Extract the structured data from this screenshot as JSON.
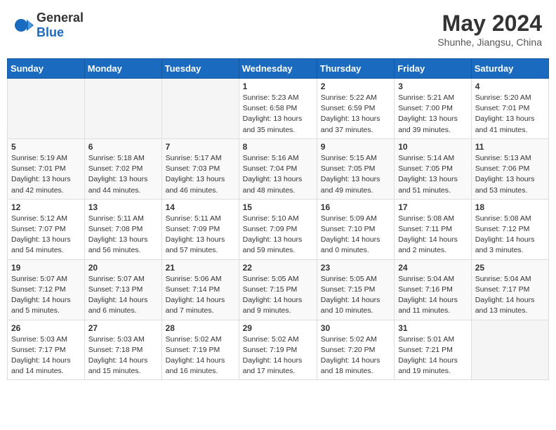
{
  "header": {
    "logo_general": "General",
    "logo_blue": "Blue",
    "month_year": "May 2024",
    "location": "Shunhe, Jiangsu, China"
  },
  "weekdays": [
    "Sunday",
    "Monday",
    "Tuesday",
    "Wednesday",
    "Thursday",
    "Friday",
    "Saturday"
  ],
  "weeks": [
    [
      {
        "day": "",
        "info": ""
      },
      {
        "day": "",
        "info": ""
      },
      {
        "day": "",
        "info": ""
      },
      {
        "day": "1",
        "info": "Sunrise: 5:23 AM\nSunset: 6:58 PM\nDaylight: 13 hours\nand 35 minutes."
      },
      {
        "day": "2",
        "info": "Sunrise: 5:22 AM\nSunset: 6:59 PM\nDaylight: 13 hours\nand 37 minutes."
      },
      {
        "day": "3",
        "info": "Sunrise: 5:21 AM\nSunset: 7:00 PM\nDaylight: 13 hours\nand 39 minutes."
      },
      {
        "day": "4",
        "info": "Sunrise: 5:20 AM\nSunset: 7:01 PM\nDaylight: 13 hours\nand 41 minutes."
      }
    ],
    [
      {
        "day": "5",
        "info": "Sunrise: 5:19 AM\nSunset: 7:01 PM\nDaylight: 13 hours\nand 42 minutes."
      },
      {
        "day": "6",
        "info": "Sunrise: 5:18 AM\nSunset: 7:02 PM\nDaylight: 13 hours\nand 44 minutes."
      },
      {
        "day": "7",
        "info": "Sunrise: 5:17 AM\nSunset: 7:03 PM\nDaylight: 13 hours\nand 46 minutes."
      },
      {
        "day": "8",
        "info": "Sunrise: 5:16 AM\nSunset: 7:04 PM\nDaylight: 13 hours\nand 48 minutes."
      },
      {
        "day": "9",
        "info": "Sunrise: 5:15 AM\nSunset: 7:05 PM\nDaylight: 13 hours\nand 49 minutes."
      },
      {
        "day": "10",
        "info": "Sunrise: 5:14 AM\nSunset: 7:05 PM\nDaylight: 13 hours\nand 51 minutes."
      },
      {
        "day": "11",
        "info": "Sunrise: 5:13 AM\nSunset: 7:06 PM\nDaylight: 13 hours\nand 53 minutes."
      }
    ],
    [
      {
        "day": "12",
        "info": "Sunrise: 5:12 AM\nSunset: 7:07 PM\nDaylight: 13 hours\nand 54 minutes."
      },
      {
        "day": "13",
        "info": "Sunrise: 5:11 AM\nSunset: 7:08 PM\nDaylight: 13 hours\nand 56 minutes."
      },
      {
        "day": "14",
        "info": "Sunrise: 5:11 AM\nSunset: 7:09 PM\nDaylight: 13 hours\nand 57 minutes."
      },
      {
        "day": "15",
        "info": "Sunrise: 5:10 AM\nSunset: 7:09 PM\nDaylight: 13 hours\nand 59 minutes."
      },
      {
        "day": "16",
        "info": "Sunrise: 5:09 AM\nSunset: 7:10 PM\nDaylight: 14 hours\nand 0 minutes."
      },
      {
        "day": "17",
        "info": "Sunrise: 5:08 AM\nSunset: 7:11 PM\nDaylight: 14 hours\nand 2 minutes."
      },
      {
        "day": "18",
        "info": "Sunrise: 5:08 AM\nSunset: 7:12 PM\nDaylight: 14 hours\nand 3 minutes."
      }
    ],
    [
      {
        "day": "19",
        "info": "Sunrise: 5:07 AM\nSunset: 7:12 PM\nDaylight: 14 hours\nand 5 minutes."
      },
      {
        "day": "20",
        "info": "Sunrise: 5:07 AM\nSunset: 7:13 PM\nDaylight: 14 hours\nand 6 minutes."
      },
      {
        "day": "21",
        "info": "Sunrise: 5:06 AM\nSunset: 7:14 PM\nDaylight: 14 hours\nand 7 minutes."
      },
      {
        "day": "22",
        "info": "Sunrise: 5:05 AM\nSunset: 7:15 PM\nDaylight: 14 hours\nand 9 minutes."
      },
      {
        "day": "23",
        "info": "Sunrise: 5:05 AM\nSunset: 7:15 PM\nDaylight: 14 hours\nand 10 minutes."
      },
      {
        "day": "24",
        "info": "Sunrise: 5:04 AM\nSunset: 7:16 PM\nDaylight: 14 hours\nand 11 minutes."
      },
      {
        "day": "25",
        "info": "Sunrise: 5:04 AM\nSunset: 7:17 PM\nDaylight: 14 hours\nand 13 minutes."
      }
    ],
    [
      {
        "day": "26",
        "info": "Sunrise: 5:03 AM\nSunset: 7:17 PM\nDaylight: 14 hours\nand 14 minutes."
      },
      {
        "day": "27",
        "info": "Sunrise: 5:03 AM\nSunset: 7:18 PM\nDaylight: 14 hours\nand 15 minutes."
      },
      {
        "day": "28",
        "info": "Sunrise: 5:02 AM\nSunset: 7:19 PM\nDaylight: 14 hours\nand 16 minutes."
      },
      {
        "day": "29",
        "info": "Sunrise: 5:02 AM\nSunset: 7:19 PM\nDaylight: 14 hours\nand 17 minutes."
      },
      {
        "day": "30",
        "info": "Sunrise: 5:02 AM\nSunset: 7:20 PM\nDaylight: 14 hours\nand 18 minutes."
      },
      {
        "day": "31",
        "info": "Sunrise: 5:01 AM\nSunset: 7:21 PM\nDaylight: 14 hours\nand 19 minutes."
      },
      {
        "day": "",
        "info": ""
      }
    ]
  ]
}
